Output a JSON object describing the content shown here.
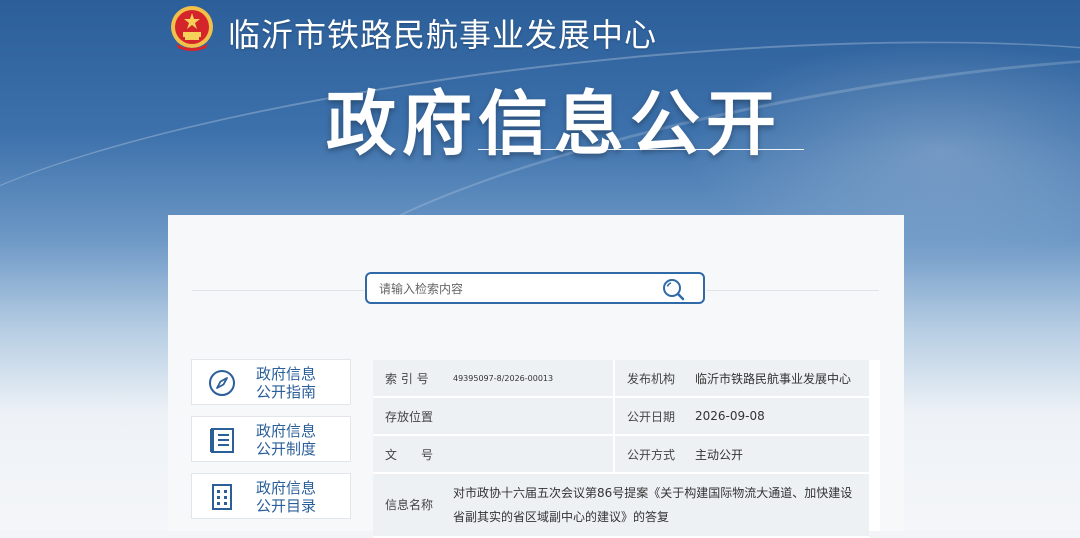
{
  "header": {
    "site_title": "临沂市铁路民航事业发展中心",
    "main_title": "政府信息公开"
  },
  "search": {
    "placeholder": "请输入检索内容"
  },
  "sidebar": {
    "items": [
      {
        "line1": "政府信息",
        "line2": "公开指南",
        "icon": "compass-icon"
      },
      {
        "line1": "政府信息",
        "line2": "公开制度",
        "icon": "document-list-icon"
      },
      {
        "line1": "政府信息",
        "line2": "公开目录",
        "icon": "catalog-grid-icon"
      }
    ]
  },
  "info": {
    "index_label": "索 引 号",
    "index_value": "49395097-8/2026-00013",
    "publisher_label": "发布机构",
    "publisher_value": "临沂市铁路民航事业发展中心",
    "location_label": "存放位置",
    "location_value": "",
    "date_label": "公开日期",
    "date_value": "2026-09-08",
    "doc_no_label": "文　　号",
    "doc_no_value": "",
    "method_label": "公开方式",
    "method_value": "主动公开",
    "name_label": "信息名称",
    "name_value": "对市政协十六届五次会议第86号提案《关于构建国际物流大通道、加快建设省副其实的省区域副中心的建议》的答复"
  },
  "colors": {
    "brand_blue": "#2f6aa6",
    "nav_text": "#2b5f9a"
  }
}
